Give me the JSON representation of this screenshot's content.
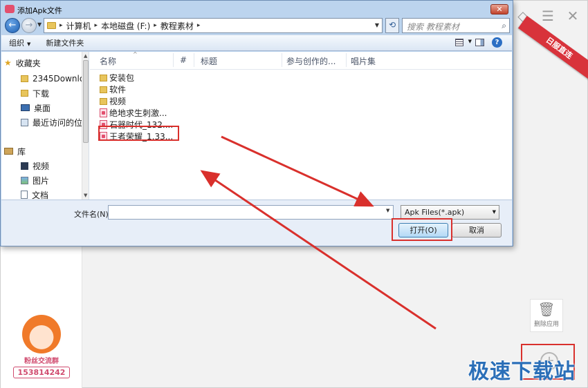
{
  "dialog": {
    "title": "添加Apk文件",
    "close_label": "✕",
    "nav": {
      "back_label": "←",
      "forward_label": "→",
      "breadcrumb": [
        "计算机",
        "本地磁盘 (F:)",
        "教程素材"
      ],
      "search_placeholder": "搜索 教程素材"
    },
    "toolbar": {
      "organize_label": "组织",
      "new_folder_label": "新建文件夹"
    },
    "sidebar": {
      "favorites_label": "收藏夹",
      "items": [
        {
          "label": "2345Downlo",
          "icon": "folder-icon"
        },
        {
          "label": "下载",
          "icon": "folder-icon"
        },
        {
          "label": "桌面",
          "icon": "desktop-icon"
        },
        {
          "label": "最近访问的位",
          "icon": "recent-places-icon"
        }
      ],
      "libraries_label": "库",
      "library_items": [
        {
          "label": "视频",
          "icon": "video-library-icon"
        },
        {
          "label": "图片",
          "icon": "picture-library-icon"
        },
        {
          "label": "文档",
          "icon": "document-library-icon"
        }
      ]
    },
    "columns": {
      "name": "名称",
      "number": "#",
      "title": "标题",
      "contributor": "参与创作的...",
      "album": "唱片集"
    },
    "files": [
      {
        "name": "安装包",
        "type": "folder"
      },
      {
        "name": "软件",
        "type": "folder"
      },
      {
        "name": "视频",
        "type": "folder"
      },
      {
        "name": "绝地求生刺激...",
        "type": "apk"
      },
      {
        "name": "石器时代_132....",
        "type": "apk"
      },
      {
        "name": "王者荣耀_1.33...",
        "type": "apk"
      }
    ],
    "filename_label": "文件名(N):",
    "filename_value": "",
    "filter_value": "Apk Files(*.apk)",
    "open_label": "打开(O)",
    "cancel_label": "取消"
  },
  "app": {
    "controls": [
      "◇",
      "☰",
      "✕"
    ],
    "ribbon_text": "日服直连",
    "fan_group_label": "粉丝交流群",
    "fan_group_number": "153814242",
    "delete_app_label": "删除应用",
    "add_icon_label": "+",
    "watermark": "极速下载站"
  },
  "colors": {
    "annotation_red": "#d9302c",
    "watermark_blue": "#2b6fb8"
  }
}
